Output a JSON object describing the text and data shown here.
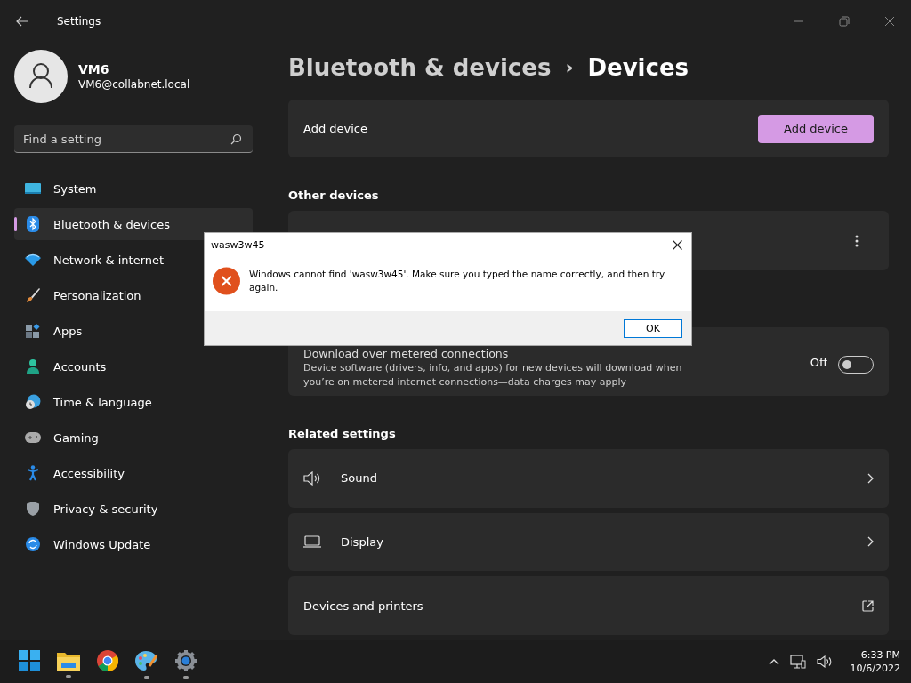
{
  "window": {
    "title": "Settings"
  },
  "profile": {
    "name": "VM6",
    "email": "VM6@collabnet.local"
  },
  "search": {
    "placeholder": "Find a setting"
  },
  "sidebar": {
    "items": [
      {
        "label": "System",
        "kind": "system",
        "selected": false
      },
      {
        "label": "Bluetooth & devices",
        "kind": "bluetooth",
        "selected": true
      },
      {
        "label": "Network & internet",
        "kind": "network",
        "selected": false
      },
      {
        "label": "Personalization",
        "kind": "brush",
        "selected": false
      },
      {
        "label": "Apps",
        "kind": "apps",
        "selected": false
      },
      {
        "label": "Accounts",
        "kind": "accounts",
        "selected": false
      },
      {
        "label": "Time & language",
        "kind": "time",
        "selected": false
      },
      {
        "label": "Gaming",
        "kind": "gaming",
        "selected": false
      },
      {
        "label": "Accessibility",
        "kind": "accessibility",
        "selected": false
      },
      {
        "label": "Privacy & security",
        "kind": "privacy",
        "selected": false
      },
      {
        "label": "Windows Update",
        "kind": "update",
        "selected": false
      }
    ]
  },
  "breadcrumb": {
    "parent": "Bluetooth & devices",
    "separator": "›",
    "current": "Devices"
  },
  "add_device": {
    "label": "Add device",
    "button": "Add device"
  },
  "other_devices": {
    "heading": "Other devices"
  },
  "metered": {
    "title": "Download over metered connections",
    "description": "Device software (drivers, info, and apps) for new devices will download when you’re on metered internet connections—data charges may apply",
    "state_label": "Off",
    "on": false
  },
  "related": {
    "heading": "Related settings",
    "items": [
      {
        "label": "Sound",
        "kind": "sound"
      },
      {
        "label": "Display",
        "kind": "display"
      },
      {
        "label": "Devices and printers",
        "kind": "external"
      }
    ]
  },
  "dialog": {
    "title": "wasw3w45",
    "message": "Windows cannot find 'wasw3w45'. Make sure you typed the name correctly, and then try again.",
    "button": "OK"
  },
  "taskbar": {
    "apps": [
      {
        "kind": "start",
        "running": false
      },
      {
        "kind": "folder",
        "running": true
      },
      {
        "kind": "browser",
        "running": false
      },
      {
        "kind": "paint",
        "running": true
      },
      {
        "kind": "settings",
        "running": true
      }
    ],
    "time": "6:33 PM",
    "date": "10/6/2022"
  }
}
